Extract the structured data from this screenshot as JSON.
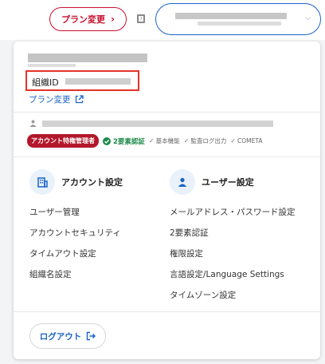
{
  "topbar": {
    "plan_button_label": "プラン変更",
    "plan_button_chevron": "›",
    "account_chevron": "⌵"
  },
  "org": {
    "id_label": "組織ID",
    "plan_link_label": "プラン変更"
  },
  "user": {
    "role_badge": "アカウント特権管理者",
    "two_factor_badge": "2要素認証",
    "features": [
      "基本機能",
      "監査ログ出力",
      "COMETA"
    ]
  },
  "account_settings": {
    "title": "アカウント設定",
    "items": [
      "ユーザー管理",
      "アカウントセキュリティ",
      "タイムアウト設定",
      "組織名設定"
    ]
  },
  "user_settings": {
    "title": "ユーザー設定",
    "items": [
      "メールアドレス・パスワード設定",
      "2要素認証",
      "権限設定",
      "言語設定/Language Settings",
      "タイムゾーン設定"
    ]
  },
  "logout": {
    "label": "ログアウト"
  },
  "colors": {
    "accent_blue": "#1a63c8",
    "brand_red": "#c8102e",
    "role_red": "#b3172b",
    "success_green": "#1f8a4c",
    "highlight_red": "#e5332a"
  }
}
